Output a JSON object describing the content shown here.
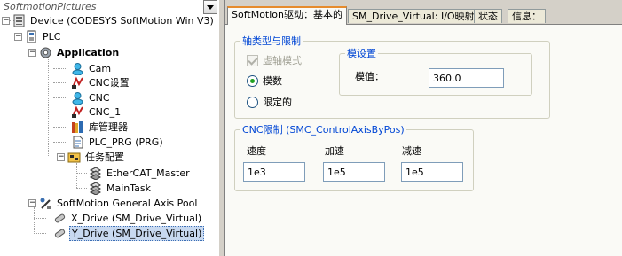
{
  "tree": {
    "title": "SoftmotionPictures",
    "items": [
      {
        "label": "Device (CODESYS SoftMotion Win V3)"
      },
      {
        "label": "PLC"
      },
      {
        "label": "Application"
      },
      {
        "label": "Cam"
      },
      {
        "label": "CNC设置"
      },
      {
        "label": "CNC"
      },
      {
        "label": "CNC_1"
      },
      {
        "label": "库管理器"
      },
      {
        "label": "PLC_PRG (PRG)"
      },
      {
        "label": "任务配置"
      },
      {
        "label": "EtherCAT_Master"
      },
      {
        "label": "MainTask"
      },
      {
        "label": "SoftMotion General Axis Pool"
      },
      {
        "label": "X_Drive (SM_Drive_Virtual)"
      },
      {
        "label": "Y_Drive (SM_Drive_Virtual)"
      }
    ]
  },
  "tabs": [
    {
      "label": "SoftMotion驱动：基本的"
    },
    {
      "label": "SM_Drive_Virtual: I/O映射"
    },
    {
      "label": "状态"
    },
    {
      "label": "信息："
    }
  ],
  "axis_group": {
    "legend": "轴类型与限制",
    "virtual_mode_label": "虚轴模式",
    "modulo_label": "模数",
    "finite_label": "限定的"
  },
  "modulo_group": {
    "legend": "模设置",
    "value_label": "模值：",
    "value": "360.0"
  },
  "cnc_group": {
    "legend": "CNC限制 (SMC_ControlAxisByPos)",
    "velocity_label": "速度",
    "velocity_value": "1e3",
    "accel_label": "加速",
    "accel_value": "1e5",
    "decel_label": "减速",
    "decel_value": "1e5"
  }
}
